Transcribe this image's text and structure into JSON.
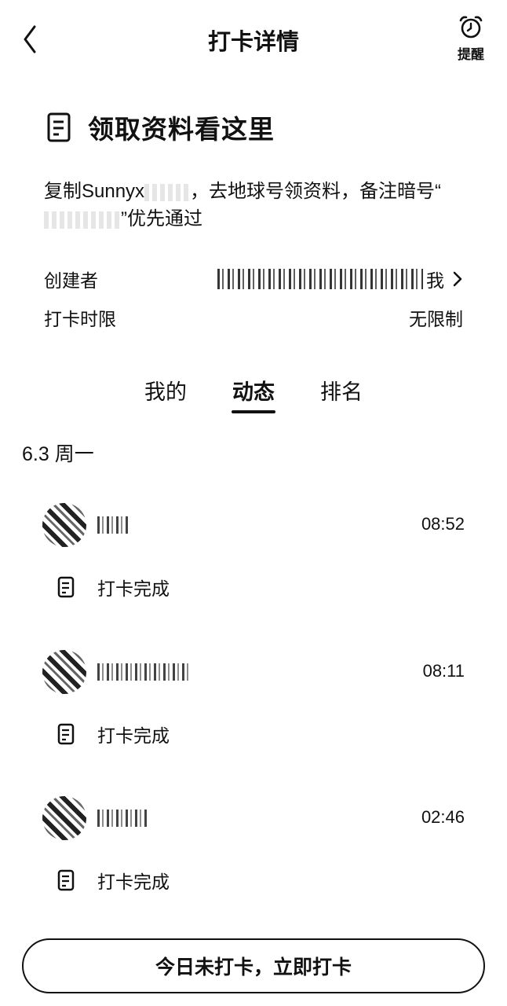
{
  "nav": {
    "title": "打卡详情",
    "remind_label": "提醒"
  },
  "section": {
    "title": "领取资料看这里"
  },
  "description": {
    "part1": "复制Sunnyx",
    "part2": "，去地球号领资料，备注暗号“",
    "part3": "”优先通过"
  },
  "info": {
    "creator_label": "创建者",
    "creator_suffix": "我",
    "limit_label": "打卡时限",
    "limit_value": "无限制"
  },
  "tabs": [
    {
      "label": "我的",
      "active": false
    },
    {
      "label": "动态",
      "active": true
    },
    {
      "label": "排名",
      "active": false
    }
  ],
  "date": "6.3 周一",
  "entries": [
    {
      "time": "08:52",
      "status": "打卡完成"
    },
    {
      "time": "08:11",
      "status": "打卡完成"
    },
    {
      "time": "02:46",
      "status": "打卡完成"
    }
  ],
  "cta": {
    "label": "今日未打卡，立即打卡"
  },
  "colors": {
    "text": "#111111",
    "background": "#ffffff"
  },
  "icons": [
    "back-icon",
    "alarm-clock-icon",
    "document-icon",
    "chevron-right-icon"
  ]
}
